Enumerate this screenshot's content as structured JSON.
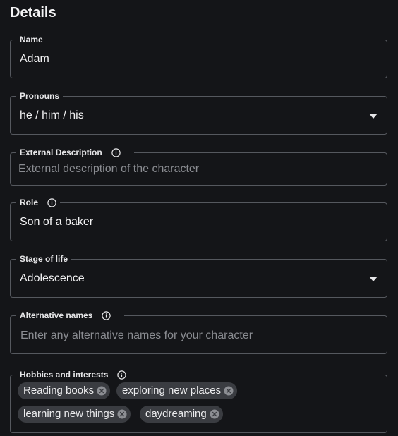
{
  "section": {
    "title": "Details"
  },
  "fields": {
    "name": {
      "label": "Name",
      "value": "Adam"
    },
    "pronouns": {
      "label": "Pronouns",
      "value": "he / him / his"
    },
    "external_description": {
      "label": "External Description",
      "placeholder": "External description of the character"
    },
    "role": {
      "label": "Role",
      "value": "Son of a baker"
    },
    "stage_of_life": {
      "label": "Stage of life",
      "value": "Adolescence"
    },
    "alternative_names": {
      "label": "Alternative names",
      "placeholder": "Enter any alternative names for your character"
    },
    "hobbies": {
      "label": "Hobbies and interests",
      "chips": [
        "Reading books",
        "exploring new places",
        "learning new things",
        "daydreaming"
      ]
    }
  },
  "icons": {
    "info": "info-icon",
    "dropdown": "caret-down-icon",
    "chip_remove": "remove-chip-icon"
  },
  "colors": {
    "background": "#141518",
    "border": "#55585e",
    "text": "#f2f2f3",
    "placeholder": "#8a8c91",
    "chip_background": "#3a3c41"
  }
}
